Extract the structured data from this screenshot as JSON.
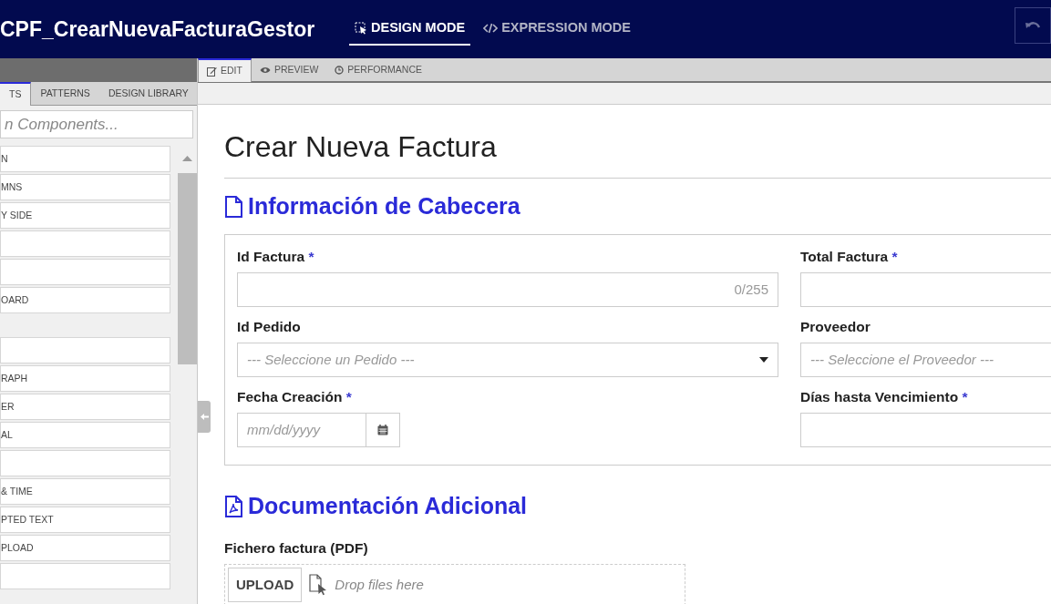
{
  "header": {
    "title": "CPF_CrearNuevaFacturaGestor",
    "modes": [
      {
        "label": "DESIGN MODE",
        "selected": true
      },
      {
        "label": "EXPRESSION MODE",
        "selected": false
      }
    ]
  },
  "sidebar": {
    "tabs": [
      {
        "label": "TS",
        "selected": true
      },
      {
        "label": "PATTERNS",
        "selected": false
      },
      {
        "label": "DESIGN LIBRARY",
        "selected": false
      }
    ],
    "search": {
      "placeholder": "n Components..."
    },
    "groups": [
      [
        {
          "kind": "text",
          "label": "N"
        },
        {
          "kind": "text",
          "label": "MNS"
        },
        {
          "kind": "text",
          "label": "Y SIDE"
        },
        {
          "kind": "blank"
        },
        {
          "kind": "blank"
        },
        {
          "kind": "text",
          "label": "OARD"
        }
      ],
      [
        {
          "kind": "blank"
        },
        {
          "kind": "text",
          "label": "RAPH"
        },
        {
          "kind": "text",
          "label": "ER"
        },
        {
          "kind": "text",
          "label": "AL"
        },
        {
          "kind": "blank"
        },
        {
          "kind": "text",
          "label": "& TIME"
        },
        {
          "kind": "text",
          "label": "PTED TEXT"
        },
        {
          "kind": "text",
          "label": "PLOAD"
        },
        {
          "kind": "blank"
        }
      ]
    ]
  },
  "editor_tabs": [
    {
      "label": "EDIT",
      "selected": true
    },
    {
      "label": "PREVIEW",
      "selected": false
    },
    {
      "label": "PERFORMANCE",
      "selected": false
    }
  ],
  "form": {
    "title": "Crear Nueva Factura",
    "sections": [
      {
        "heading": "Información de Cabecera",
        "kind": "panel",
        "columns": [
          [
            {
              "kind": "text",
              "label": "Id Factura",
              "required_mark": "*",
              "counter": "0/255"
            },
            {
              "kind": "select",
              "label": "Id Pedido",
              "placeholder": "--- Seleccione un Pedido ---"
            },
            {
              "kind": "date",
              "label": "Fecha Creación",
              "required_mark": "*",
              "placeholder": "mm/dd/yyyy"
            }
          ],
          [
            {
              "kind": "text",
              "label": "Total Factura",
              "required_mark": "*"
            },
            {
              "kind": "select",
              "label": "Proveedor",
              "placeholder": "--- Seleccione el Proveedor ---"
            },
            {
              "kind": "text",
              "label": "Días hasta Vencimiento",
              "required_mark": "*"
            }
          ]
        ]
      },
      {
        "heading": "Documentación Adicional",
        "kind": "plain",
        "columns": [
          [
            {
              "kind": "upload",
              "label": "Fichero factura (PDF)",
              "button": "UPLOAD",
              "hint": "Drop files here"
            }
          ]
        ]
      }
    ]
  }
}
